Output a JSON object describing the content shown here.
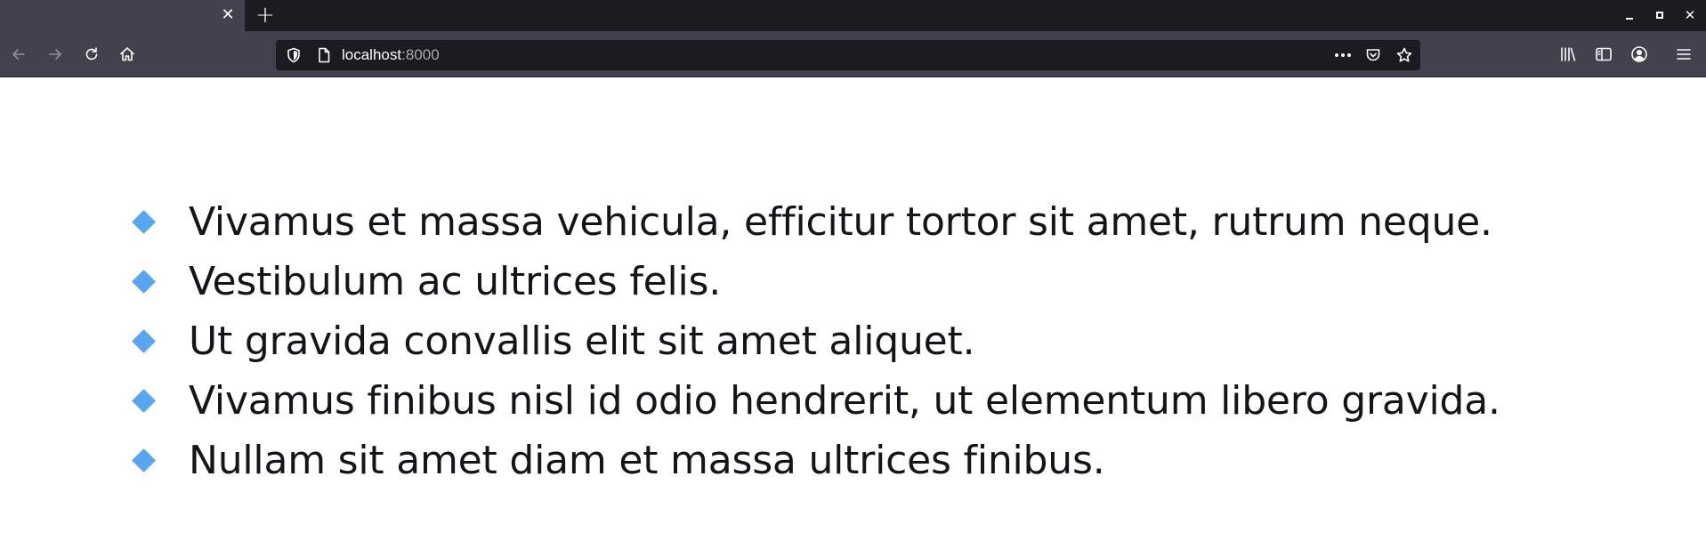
{
  "browser": {
    "tab": {
      "close_glyph": "✕"
    },
    "new_tab_glyph": "+",
    "window_controls": {
      "close_glyph": "✕"
    },
    "nav": {
      "back_icon": "arrow-left-icon",
      "forward_icon": "arrow-right-icon",
      "reload_icon": "reload-icon",
      "home_icon": "home-icon"
    },
    "url": {
      "host": "localhost",
      "port": ":8000"
    },
    "toolbar_icons": [
      "library-icon",
      "sidebar-icon",
      "account-icon",
      "menu-icon"
    ]
  },
  "page": {
    "bullet_color": "#58a6f0",
    "items": [
      "Vivamus et massa vehicula, efficitur tortor sit amet, rutrum neque.",
      "Vestibulum ac ultrices felis.",
      "Ut gravida convallis elit sit amet aliquet.",
      "Vivamus finibus nisl id odio hendrerit, ut elementum libero gravida.",
      "Nullam sit amet diam et massa ultrices finibus."
    ]
  }
}
